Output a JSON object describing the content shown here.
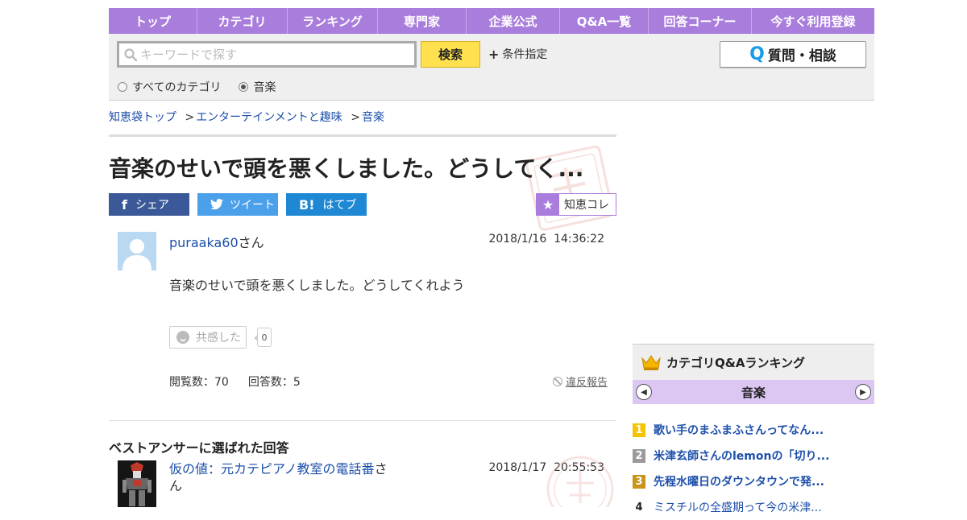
{
  "nav": {
    "items": [
      "トップ",
      "カテゴリ",
      "ランキング",
      "専門家",
      "企業公式",
      "Q&A一覧",
      "回答コーナー",
      "今すぐ利用登録"
    ]
  },
  "search": {
    "placeholder": "キーワードで探す",
    "button_label": "検索",
    "condition_label": "条件指定",
    "ask_label": "質問・相談",
    "radio_all": "すべてのカテゴリ",
    "radio_current": "音楽",
    "selected": "音楽"
  },
  "breadcrumb": {
    "items": [
      "知恵袋トップ",
      "エンターテインメントと趣味",
      "音楽"
    ],
    "separator": ">"
  },
  "question": {
    "title": "音楽のせいで頭を悪くしました。どうしてく...",
    "user": "puraaka60",
    "user_suffix": "さん",
    "timestamp": "2018/1/16  14:36:22",
    "body": "音楽のせいで頭を悪くしました。どうしてくれよう",
    "empathy_label": "共感した",
    "empathy_count": "0",
    "views": "閲覧数：70",
    "answers": "回答数：5",
    "report_label": "違反報告"
  },
  "share": {
    "facebook": "シェア",
    "twitter": "ツイート",
    "hatena": "はてブ",
    "chiecore": "知恵コレ"
  },
  "best_answer": {
    "heading": "ベストアンサーに選ばれた回答",
    "user": "仮の値：元カテピアノ教室の電話番",
    "user_suffix": "さん",
    "timestamp": "2018/1/17  20:55:53"
  },
  "ranking": {
    "title": "カテゴリQ&Aランキング",
    "category": "音楽",
    "items": [
      {
        "rank": "1",
        "text": "歌い手のまふまふさんってなん...",
        "color": "#f5c400"
      },
      {
        "rank": "2",
        "text": "米津玄師さんのlemonの「切り...",
        "color": "#9a9a9a"
      },
      {
        "rank": "3",
        "text": "先程水曜日のダウンタウンで発...",
        "color": "#c8941a"
      },
      {
        "rank": "4",
        "text": "ミスチルの全盛期って今の米津...",
        "color": ""
      }
    ]
  },
  "colors": {
    "nav_bg": "#a97ddc",
    "link": "#1d4faa",
    "search_button": "#ffe14f"
  }
}
